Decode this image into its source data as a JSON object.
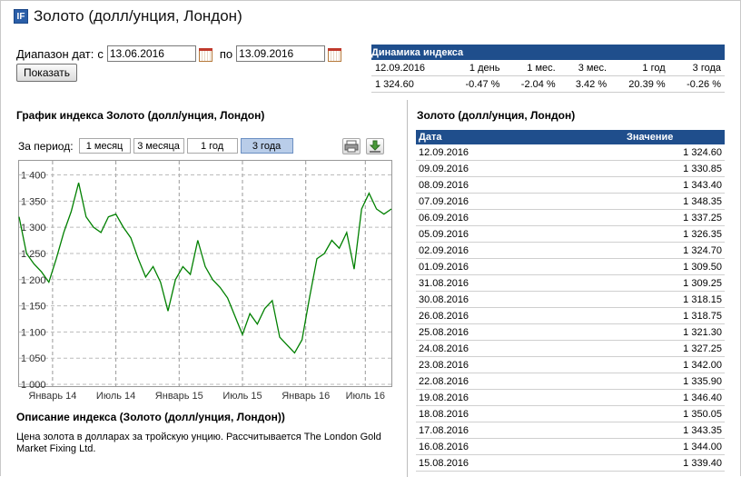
{
  "page": {
    "title": "Золото (долл/унция, Лондон)",
    "logo": "IF"
  },
  "range": {
    "label": "Диапазон дат:",
    "from_label": "с",
    "from": "13.06.2016",
    "to_label": "по",
    "to": "13.09.2016",
    "show_button": "Показать"
  },
  "dynamics": {
    "title": "Динамика индекса",
    "date": "12.09.2016",
    "headers": [
      "1 день",
      "1 мес.",
      "3 мес.",
      "1 год",
      "3 года"
    ],
    "value": "1 324.60",
    "changes": [
      "-0.47 %",
      "-2.04 %",
      "3.42 %",
      "20.39 %",
      "-0.26 %"
    ]
  },
  "chart_section": {
    "title": "График индекса Золото (долл/унция, Лондон)",
    "period_label": "За период:",
    "periods": [
      "1 месяц",
      "3 месяца",
      "1 год",
      "3 года"
    ],
    "active_period": "3 года"
  },
  "chart_data": {
    "type": "line",
    "ylim": [
      1000,
      1420
    ],
    "yticks": [
      "1 400",
      "1 350",
      "1 300",
      "1 250",
      "1 200",
      "1 150",
      "1 100",
      "1 050",
      "1 000"
    ],
    "ytick_values": [
      1400,
      1350,
      1300,
      1250,
      1200,
      1150,
      1100,
      1050,
      1000
    ],
    "xticks": [
      "Январь 14",
      "Июль 14",
      "Январь 15",
      "Июль 15",
      "Январь 16",
      "Июль 16"
    ],
    "xtick_values": [
      0.09,
      0.26,
      0.43,
      0.6,
      0.77,
      0.93
    ],
    "grid": true,
    "series": [
      {
        "color": "#008000",
        "x": [
          0,
          0.02,
          0.04,
          0.06,
          0.08,
          0.1,
          0.12,
          0.14,
          0.16,
          0.18,
          0.2,
          0.22,
          0.24,
          0.26,
          0.28,
          0.3,
          0.32,
          0.34,
          0.36,
          0.38,
          0.4,
          0.42,
          0.44,
          0.46,
          0.48,
          0.5,
          0.52,
          0.54,
          0.56,
          0.58,
          0.6,
          0.62,
          0.64,
          0.66,
          0.68,
          0.7,
          0.72,
          0.74,
          0.76,
          0.78,
          0.8,
          0.82,
          0.84,
          0.86,
          0.88,
          0.9,
          0.92,
          0.94,
          0.96,
          0.98,
          1.0
        ],
        "y": [
          1320,
          1250,
          1230,
          1215,
          1195,
          1240,
          1290,
          1330,
          1385,
          1320,
          1300,
          1290,
          1320,
          1325,
          1300,
          1280,
          1240,
          1205,
          1225,
          1195,
          1140,
          1200,
          1225,
          1210,
          1275,
          1225,
          1200,
          1185,
          1165,
          1130,
          1095,
          1135,
          1115,
          1145,
          1160,
          1090,
          1075,
          1060,
          1085,
          1165,
          1240,
          1250,
          1275,
          1260,
          1290,
          1220,
          1335,
          1365,
          1335,
          1325,
          1335
        ]
      }
    ]
  },
  "description": {
    "title": "Описание индекса  (Золото (долл/унция, Лондон))",
    "text": "Цена золота в долларах за тройскую унцию. Рассчитывается The London Gold Market Fixing Ltd."
  },
  "quotes": {
    "title": "Золото (долл/унция, Лондон)",
    "headers": [
      "Дата",
      "Значение"
    ],
    "rows": [
      [
        "12.09.2016",
        "1 324.60"
      ],
      [
        "09.09.2016",
        "1 330.85"
      ],
      [
        "08.09.2016",
        "1 343.40"
      ],
      [
        "07.09.2016",
        "1 348.35"
      ],
      [
        "06.09.2016",
        "1 337.25"
      ],
      [
        "05.09.2016",
        "1 326.35"
      ],
      [
        "02.09.2016",
        "1 324.70"
      ],
      [
        "01.09.2016",
        "1 309.50"
      ],
      [
        "31.08.2016",
        "1 309.25"
      ],
      [
        "30.08.2016",
        "1 318.15"
      ],
      [
        "26.08.2016",
        "1 318.75"
      ],
      [
        "25.08.2016",
        "1 321.30"
      ],
      [
        "24.08.2016",
        "1 327.25"
      ],
      [
        "23.08.2016",
        "1 342.00"
      ],
      [
        "22.08.2016",
        "1 335.90"
      ],
      [
        "19.08.2016",
        "1 346.40"
      ],
      [
        "18.08.2016",
        "1 350.05"
      ],
      [
        "17.08.2016",
        "1 343.35"
      ],
      [
        "16.08.2016",
        "1 344.00"
      ],
      [
        "15.08.2016",
        "1 339.40"
      ]
    ]
  }
}
